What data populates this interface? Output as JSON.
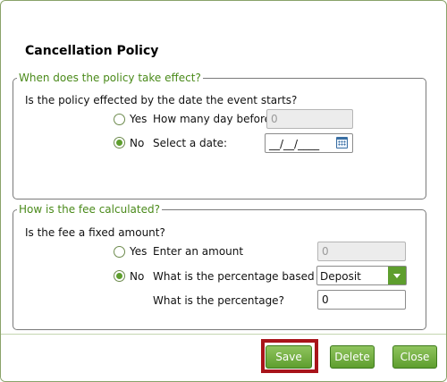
{
  "dialog": {
    "title": "Cancellation Policy"
  },
  "effect_group": {
    "legend": "When does the policy take effect?",
    "question": "Is the policy effected by the date the event starts?",
    "options": [
      {
        "label": "Yes",
        "selected": false,
        "field_label": "How many day before?",
        "field_value": "0",
        "field_enabled": false
      },
      {
        "label": "No",
        "selected": true,
        "field_label": "Select a date:",
        "field_value": "__/__/____",
        "field_enabled": true
      }
    ]
  },
  "fee_group": {
    "legend": "How is the fee calculated?",
    "question": "Is the fee a fixed amount?",
    "options": [
      {
        "label": "Yes",
        "selected": false,
        "field_label": "Enter an amount",
        "field_value": "0",
        "field_enabled": false
      },
      {
        "label": "No",
        "selected": true,
        "field_label": "What is the percentage based on?",
        "field_value": "Deposit",
        "field_enabled": true
      }
    ],
    "percentage_label": "What is the percentage?",
    "percentage_value": "0"
  },
  "buttons": {
    "save": "Save",
    "delete": "Delete",
    "close": "Close"
  },
  "colors": {
    "accent": "#5e9e2e",
    "legend_text": "#4a8a1a",
    "highlight": "#a8141a"
  },
  "icons": {
    "date_picker": "calendar-icon",
    "dropdown": "chevron-down-icon"
  }
}
